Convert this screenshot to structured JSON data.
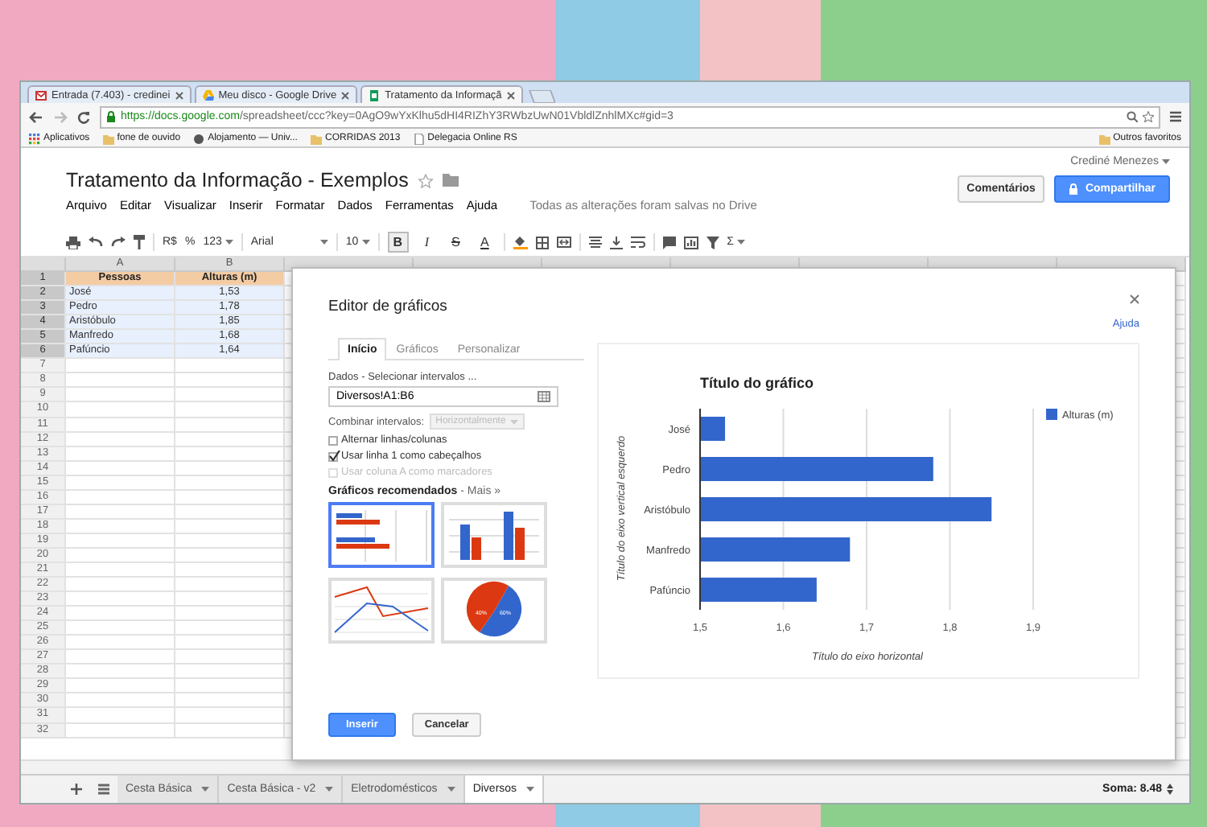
{
  "browser": {
    "tabs": [
      {
        "title": "Entrada (7.403) - credinei",
        "kind": "mail",
        "selected": false
      },
      {
        "title": "Meu disco - Google Drive",
        "kind": "drive",
        "selected": false
      },
      {
        "title": "Tratamento da Informaçã",
        "kind": "sheets",
        "selected": true
      }
    ],
    "address": {
      "secure_part": "https://docs.google.com",
      "path": "/spreadsheet/ccc?key=0AgO9wYxKlhu5dHI4RIZhY3RWbzUwN01VbldlZnhlMXc#gid=3"
    },
    "bookmarks": [
      {
        "label": "Aplicativos",
        "kind": "apps"
      },
      {
        "label": "fone de ouvido",
        "kind": "folder"
      },
      {
        "label": "Alojamento — Univ...",
        "kind": "site"
      },
      {
        "label": "CORRIDAS 2013",
        "kind": "folder"
      },
      {
        "label": "Delegacia Online RS",
        "kind": "page"
      }
    ],
    "other_bookmarks": "Outros favoritos"
  },
  "document": {
    "title": "Tratamento da Informação - Exemplos",
    "user": "Crediné Menezes",
    "menu": [
      "Arquivo",
      "Editar",
      "Visualizar",
      "Inserir",
      "Formatar",
      "Dados",
      "Ferramentas",
      "Ajuda"
    ],
    "save_status": "Todas as alterações foram salvas no Drive",
    "comments_button": "Comentários",
    "share_button": "Compartilhar"
  },
  "toolbar": {
    "currency": "R$",
    "percent": "%",
    "number_format": "123",
    "font": "Arial",
    "font_size": "10",
    "format_buttons": [
      {
        "label": "B",
        "kind": "bold",
        "on": true
      },
      {
        "label": "I",
        "kind": "italic",
        "on": false
      },
      {
        "label": "S",
        "kind": "strike",
        "on": false
      },
      {
        "label": "A",
        "kind": "color",
        "on": false
      }
    ],
    "functions": "Σ"
  },
  "sheet": {
    "columns": [
      "A",
      "B"
    ],
    "row_numbers": [
      "1",
      "2",
      "3",
      "4",
      "5",
      "6",
      "7",
      "8",
      "9",
      "10",
      "11",
      "12",
      "13",
      "14",
      "15",
      "16",
      "17",
      "18",
      "19",
      "20",
      "21",
      "22",
      "23",
      "24",
      "25",
      "26",
      "27",
      "28",
      "29",
      "30",
      "31",
      "32"
    ],
    "rows": [
      {
        "kind": "header",
        "selected": true,
        "cells": [
          "Pessoas",
          "Alturas (m)"
        ]
      },
      {
        "kind": "data",
        "selected": true,
        "cells": [
          "José",
          "1,53"
        ]
      },
      {
        "kind": "data",
        "selected": true,
        "cells": [
          "Pedro",
          "1,78"
        ]
      },
      {
        "kind": "data",
        "selected": true,
        "cells": [
          "Aristóbulo",
          "1,85"
        ]
      },
      {
        "kind": "data",
        "selected": true,
        "cells": [
          "Manfredo",
          "1,68"
        ]
      },
      {
        "kind": "data",
        "selected": true,
        "cells": [
          "Pafúncio",
          "1,64"
        ]
      }
    ]
  },
  "chart_editor": {
    "title": "Editor de gráficos",
    "help": "Ajuda",
    "tabs": [
      {
        "label": "Início",
        "selected": true
      },
      {
        "label": "Gráficos",
        "selected": false
      },
      {
        "label": "Personalizar",
        "selected": false
      }
    ],
    "data_label": "Dados - Selecionar intervalos ...",
    "range": "Diversos!A1:B6",
    "combine_label": "Combinar intervalos:",
    "combine": {
      "value": "Horizontalmente",
      "disabled": true
    },
    "options": [
      {
        "label": "Alternar linhas/colunas",
        "checked": false,
        "disabled": false
      },
      {
        "label": "Usar linha 1 como cabeçalhos",
        "checked": true,
        "disabled": false
      },
      {
        "label": "Usar coluna A como marcadores",
        "checked": false,
        "disabled": true
      }
    ],
    "recommended_title": "Gráficos recomendados",
    "more": "- Mais »",
    "thumbnails": [
      {
        "kind": "bar",
        "selected": true
      },
      {
        "kind": "column",
        "selected": false
      },
      {
        "kind": "line",
        "selected": false
      },
      {
        "kind": "pie",
        "selected": false,
        "labels": [
          "40%",
          "60%"
        ]
      }
    ],
    "insert_button": "Inserir",
    "cancel_button": "Cancelar",
    "chart_data": {
      "type": "bar",
      "orientation": "horizontal",
      "title": "Título do gráfico",
      "xlabel": "Título do eixo horizontal",
      "ylabel": "Título do eixo vertical esquerdo",
      "categories": [
        "José",
        "Pedro",
        "Aristóbulo",
        "Manfredo",
        "Pafúncio"
      ],
      "series": [
        {
          "name": "Alturas (m)",
          "color": "#3366cc",
          "values": [
            1.53,
            1.78,
            1.85,
            1.68,
            1.64
          ]
        }
      ],
      "xlim": [
        1.5,
        1.9
      ],
      "grid": true,
      "xticks": [
        {
          "value": 1.5,
          "label": "1,5"
        },
        {
          "value": 1.6,
          "label": "1,6"
        },
        {
          "value": 1.7,
          "label": "1,7"
        },
        {
          "value": 1.8,
          "label": "1,8"
        },
        {
          "value": 1.9,
          "label": "1,9"
        }
      ]
    }
  },
  "sheet_tabs": [
    {
      "label": "Cesta Básica",
      "selected": false
    },
    {
      "label": "Cesta Básica - v2",
      "selected": false
    },
    {
      "label": "Eletrodomésticos",
      "selected": false
    },
    {
      "label": "Diversos",
      "selected": true
    }
  ],
  "sum": "Soma: 8.48"
}
